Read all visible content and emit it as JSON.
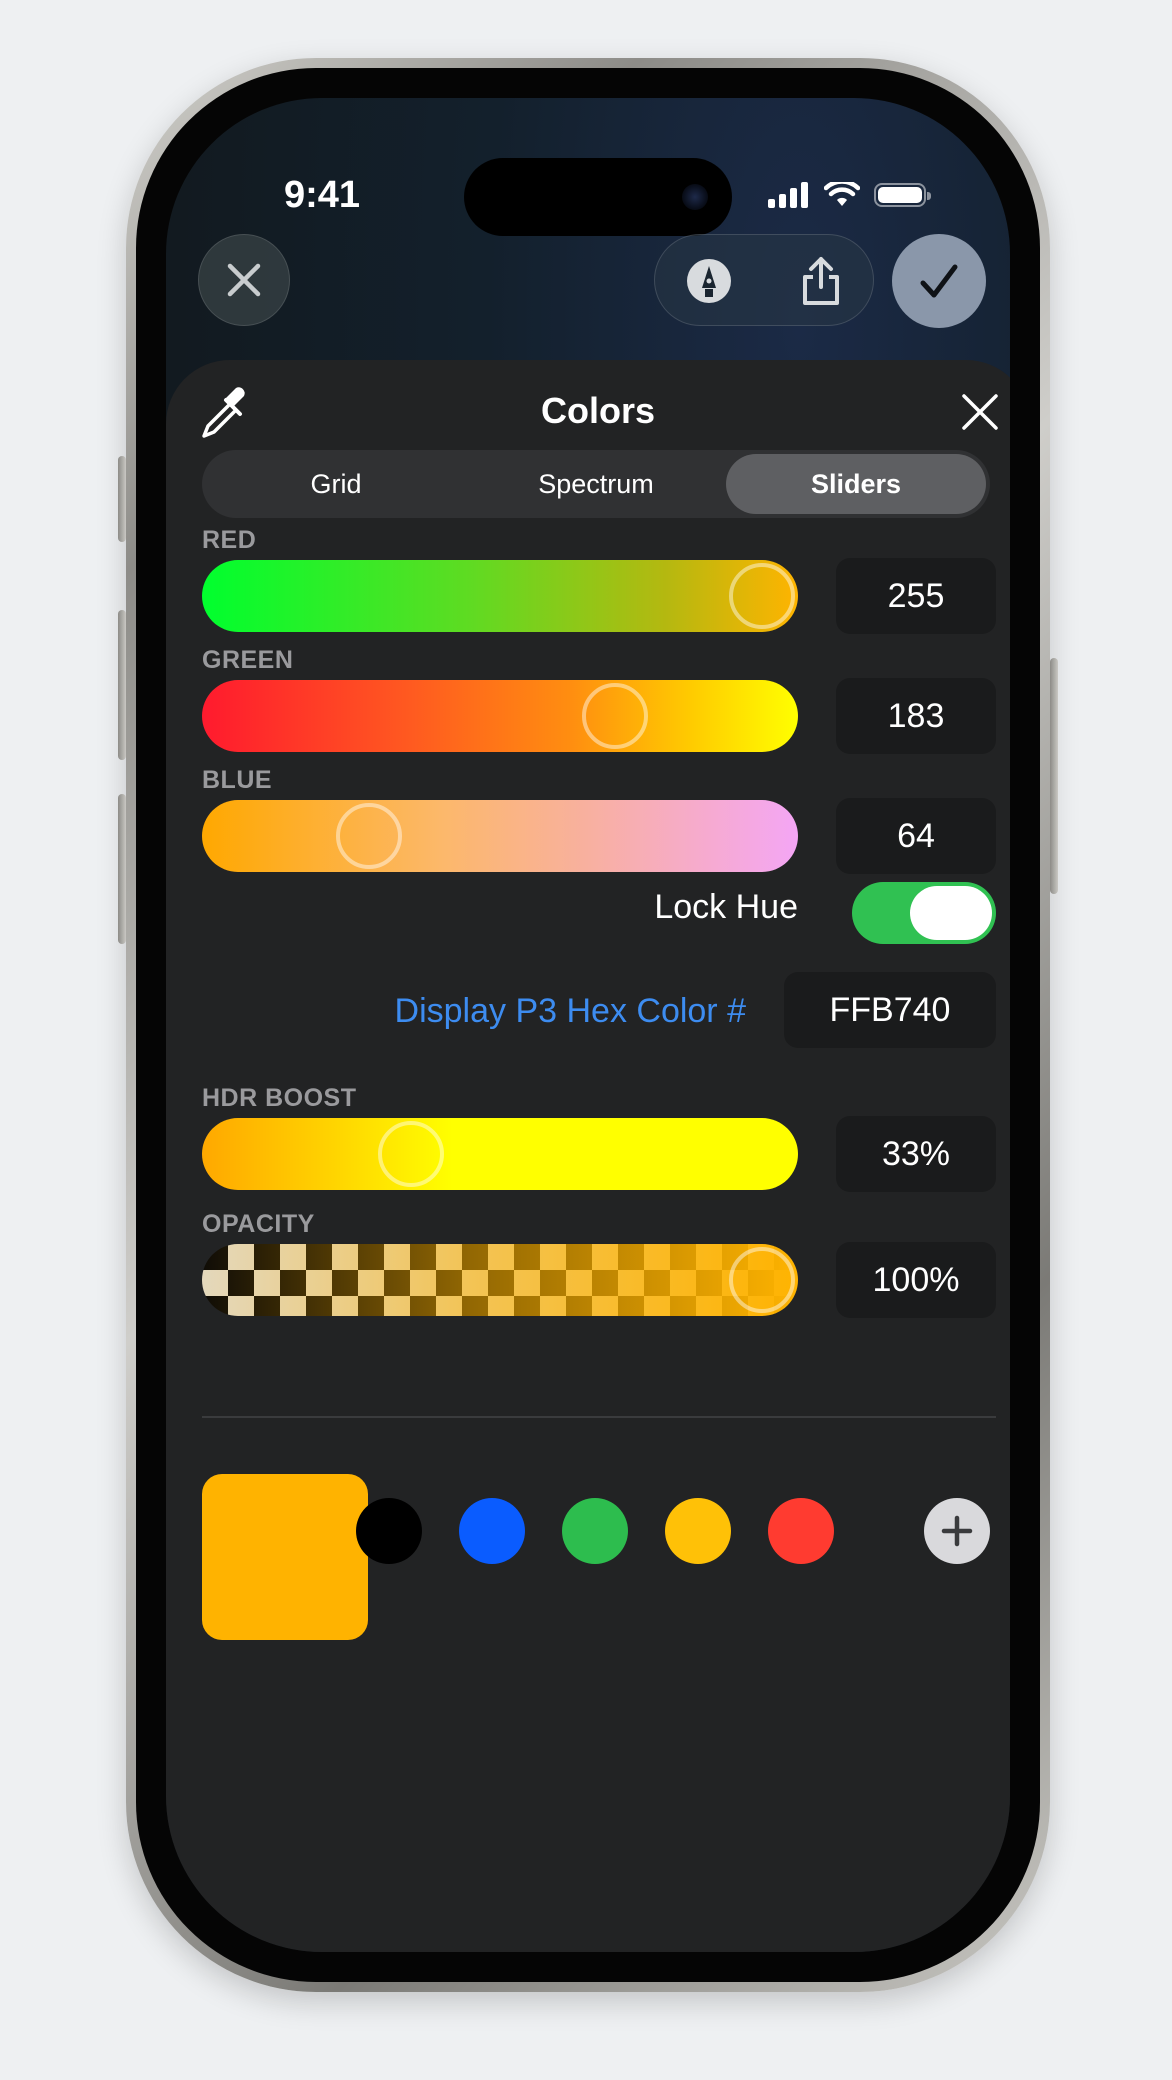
{
  "status_bar": {
    "time": "9:41"
  },
  "sheet": {
    "title": "Colors"
  },
  "tabs": [
    {
      "label": "Grid",
      "active": false
    },
    {
      "label": "Spectrum",
      "active": false
    },
    {
      "label": "Sliders",
      "active": true
    }
  ],
  "sliders": {
    "red": {
      "label": "RED",
      "value": "255",
      "level": 1.0
    },
    "green": {
      "label": "GREEN",
      "value": "183",
      "level": 0.72
    },
    "blue": {
      "label": "BLUE",
      "value": "64",
      "level": 0.25
    },
    "hdr": {
      "label": "HDR BOOST",
      "value": "33%",
      "level": 0.33
    },
    "opacity": {
      "label": "OPACITY",
      "value": "100%",
      "level": 1.0
    }
  },
  "lock_hue": {
    "label": "Lock Hue",
    "on": true
  },
  "hex": {
    "label": "Display P3 Hex Color #",
    "value": "FFB740"
  },
  "current_color": "#ffb300",
  "swatches": [
    "#000000",
    "#0a5cff",
    "#2dbd4e",
    "#ffc107",
    "#ff3b30"
  ],
  "colors": {
    "accent_blue": "#3d8cf0",
    "toggle_green": "#30c152"
  }
}
